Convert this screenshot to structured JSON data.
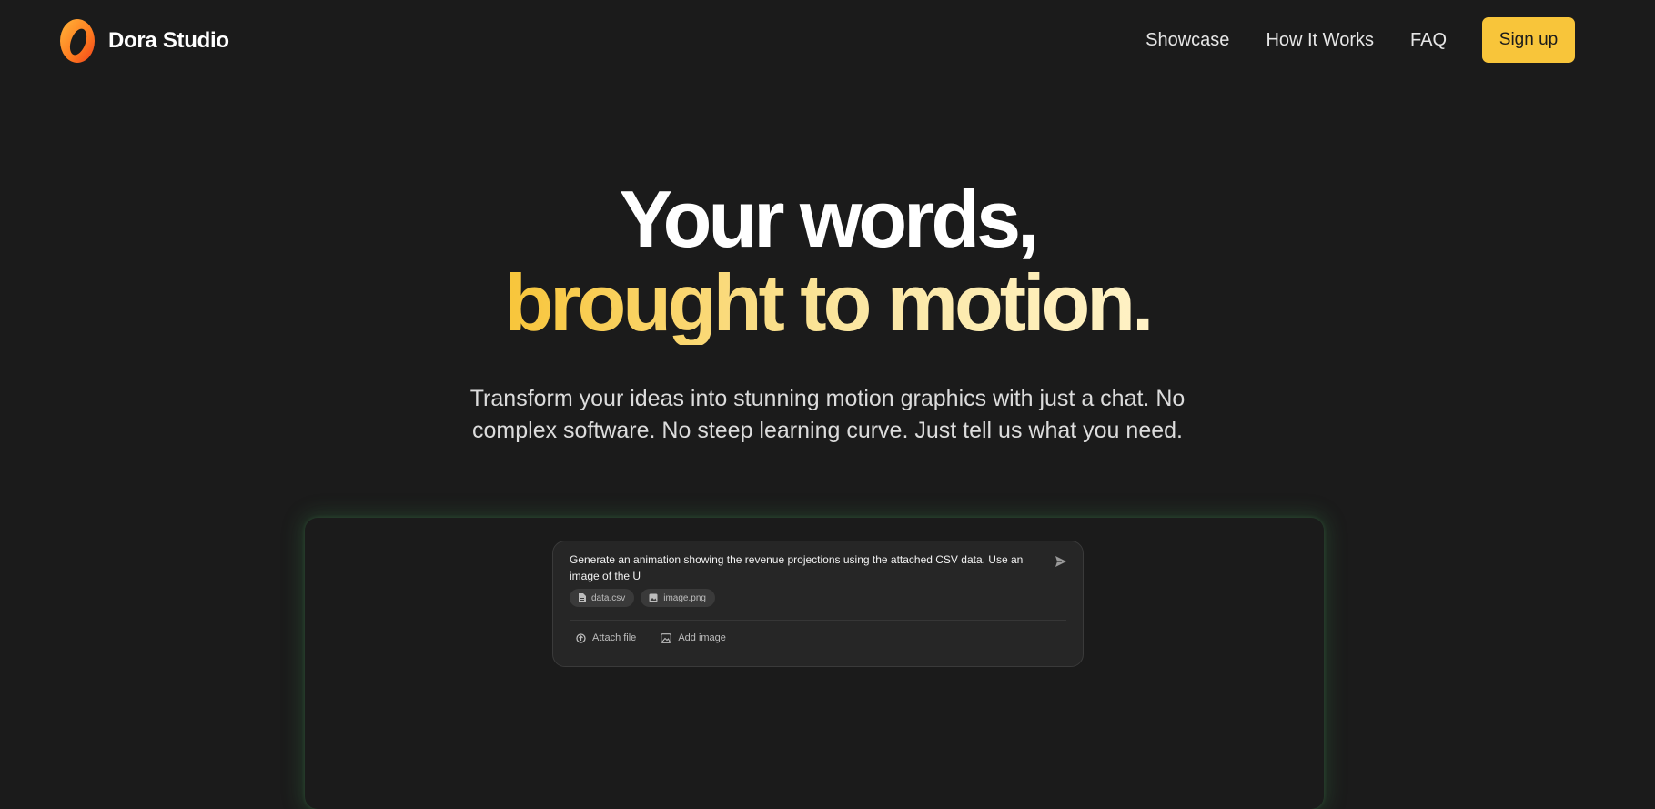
{
  "header": {
    "brand_name": "Dora Studio",
    "logo_icon": "dora-ring-logo-icon",
    "nav": [
      {
        "label": "Showcase"
      },
      {
        "label": "How It Works"
      },
      {
        "label": "FAQ"
      }
    ],
    "signup_label": "Sign up"
  },
  "hero": {
    "headline_line1": "Your words,",
    "headline_line2": "brought to motion.",
    "subtitle_line1": "Transform your ideas into stunning motion graphics with just a chat. No",
    "subtitle_line2": "complex software. No steep learning curve. Just tell us what you need."
  },
  "chat": {
    "prompt": "Generate an animation showing the revenue projections using the attached CSV data. Use an image of the U",
    "send_icon": "send-icon",
    "attachments": [
      {
        "label": "data.csv",
        "icon": "file-icon"
      },
      {
        "label": "image.png",
        "icon": "image-icon"
      }
    ],
    "actions": [
      {
        "label": "Attach file",
        "icon": "attach-icon"
      },
      {
        "label": "Add image",
        "icon": "image-icon"
      }
    ]
  },
  "colors": {
    "background": "#1b1b1b",
    "accent": "#f8c53a",
    "accent_light": "#fbe7a3",
    "glow": "#3c8c50"
  }
}
